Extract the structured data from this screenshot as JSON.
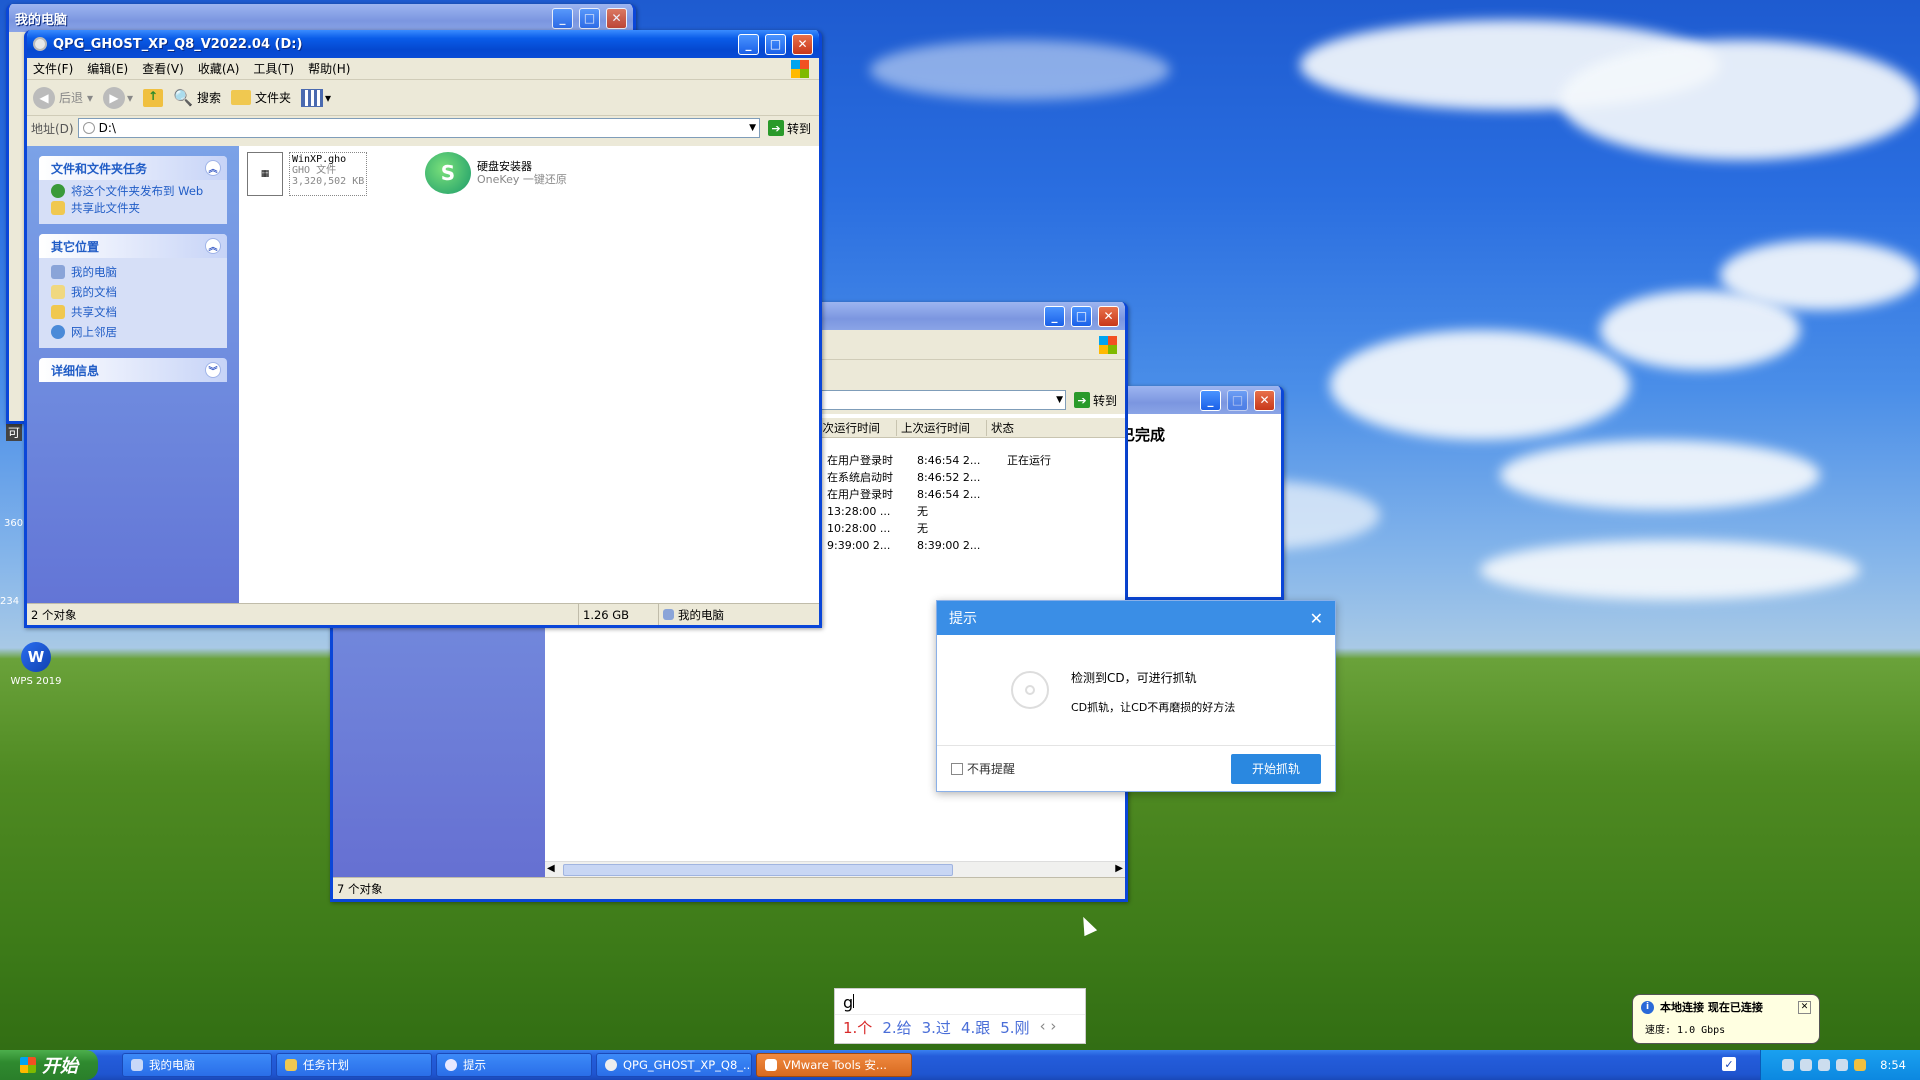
{
  "desktop": {
    "icon_wps": "WPS 2019",
    "edge_labels": [
      "可",
      "234",
      "360",
      "234"
    ]
  },
  "bg_window_mycomputer": {
    "title": "我的电脑"
  },
  "explorer": {
    "title": "QPG_GHOST_XP_Q8_V2022.04 (D:)",
    "menu": [
      "文件(F)",
      "编辑(E)",
      "查看(V)",
      "收藏(A)",
      "工具(T)",
      "帮助(H)"
    ],
    "toolbar": {
      "back": "后退",
      "search": "搜索",
      "folders": "文件夹"
    },
    "address_label": "地址(D)",
    "address_value": "D:\\",
    "go_label": "转到",
    "tasks_panel": {
      "header": "文件和文件夹任务",
      "items": [
        "将这个文件夹发布到 Web",
        "共享此文件夹"
      ]
    },
    "places_panel": {
      "header": "其它位置",
      "items": [
        "我的电脑",
        "我的文档",
        "共享文档",
        "网上邻居"
      ]
    },
    "details_panel": {
      "header": "详细信息"
    },
    "files": [
      {
        "name": "WinXP.gho",
        "type": "GHO 文件",
        "size": "3,320,502 KB",
        "icon": "gho-file-icon"
      },
      {
        "name": "硬盘安装器",
        "type": "OneKey 一键还原",
        "icon": "onekey-installer-icon"
      }
    ],
    "status": {
      "count": "2 个对象",
      "size": "1.26 GB",
      "location": "我的电脑"
    }
  },
  "scheduled_tasks": {
    "go_label": "转到",
    "columns": [
      "下次运行时间",
      "上次运行时间",
      "状态"
    ],
    "rows": [
      [
        "在用户登录时",
        "8:46:54  2...",
        "正在运行"
      ],
      [
        "在系统启动时",
        "8:46:52  2...",
        ""
      ],
      [
        "在用户登录时",
        "8:46:54  2...",
        ""
      ],
      [
        "13:28:00 ...",
        "无",
        ""
      ],
      [
        "10:28:00 ...",
        "无",
        ""
      ],
      [
        "9:39:00  2...",
        "8:39:00  2...",
        ""
      ]
    ],
    "status": "7 个对象"
  },
  "third_window": {
    "partial_text": "已完成"
  },
  "dialog": {
    "title": "提示",
    "message1": "检测到CD，可进行抓轨",
    "message2": "CD抓轨，让CD不再磨损的好方法",
    "checkbox": "不再提醒",
    "button": "开始抓轨"
  },
  "ime": {
    "input": "g",
    "candidates": [
      "1.个",
      "2.给",
      "3.过",
      "4.跟",
      "5.刚"
    ]
  },
  "balloon": {
    "title": "本地连接 现在已连接",
    "body": "速度: 1.0 Gbps"
  },
  "taskbar": {
    "start": "开始",
    "tasks": [
      "我的电脑",
      "任务计划",
      "提示",
      "QPG_GHOST_XP_Q8_...",
      "VMware Tools 安..."
    ],
    "clock": "8:54"
  }
}
